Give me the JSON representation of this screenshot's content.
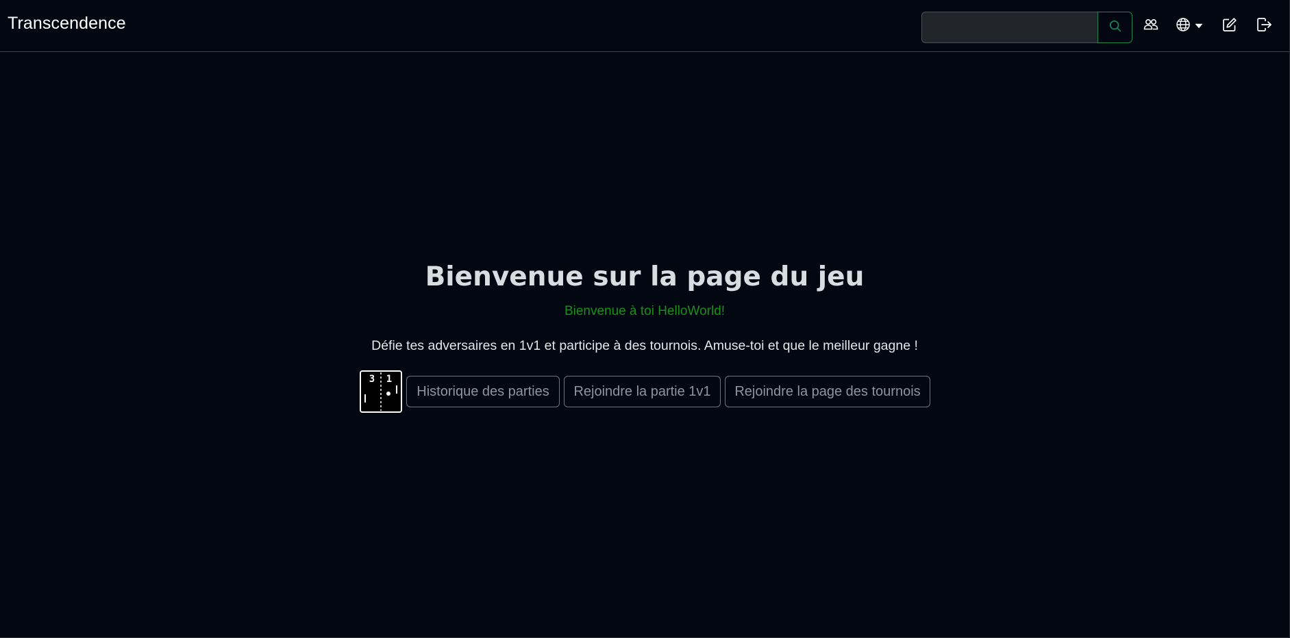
{
  "navbar": {
    "brand": "Transcendence",
    "search": {
      "value": "",
      "placeholder": ""
    },
    "icons": {
      "search": "search-icon",
      "friends": "people-icon",
      "language": "globe-icon",
      "language_caret": "caret-down-icon",
      "edit": "pencil-square-icon",
      "logout": "box-arrow-right-icon"
    },
    "accent_color": "#198754"
  },
  "main": {
    "title": "Bienvenue sur la page du jeu",
    "welcome": "Bienvenue à toi HelloWorld!",
    "description": "Défie tes adversaires en 1v1 et participe à des tournois. Amuse-toi et que le meilleur gagne !",
    "logo": {
      "score_left": "3",
      "score_right": "1"
    },
    "buttons": {
      "history": "Historique des parties",
      "join_1v1": "Rejoindre la partie 1v1",
      "tournaments": "Rejoindre la page des tournois"
    },
    "welcome_color": "#1a8f1a"
  }
}
